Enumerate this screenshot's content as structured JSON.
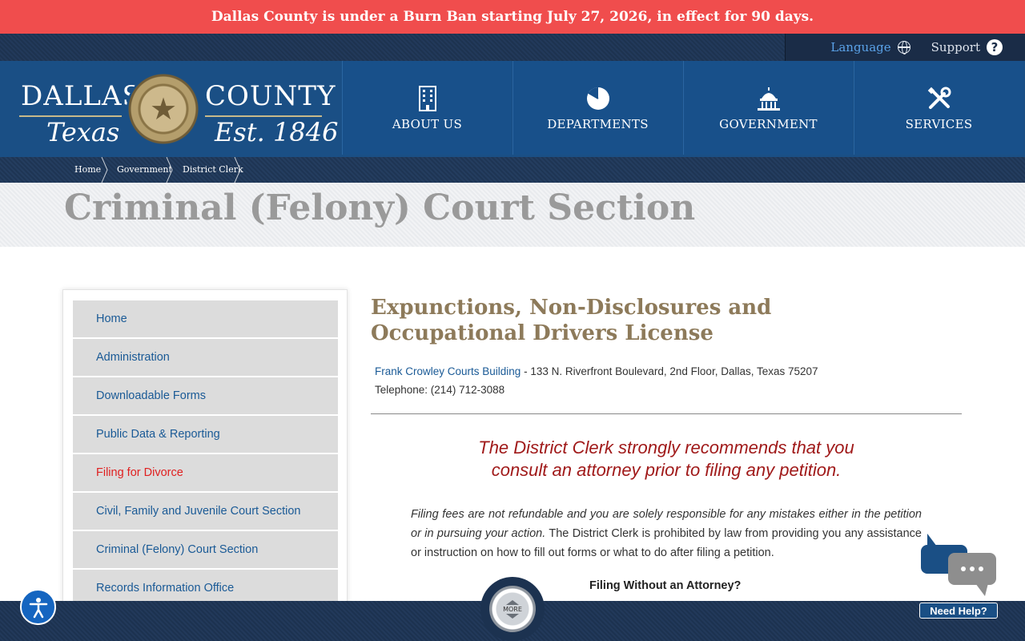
{
  "alert": {
    "text": "Dallas County is under a Burn Ban starting July 27, 2026, in effect for 90 days."
  },
  "utility": {
    "language": "Language",
    "support": "Support"
  },
  "logo": {
    "line1_left": "DALLAS",
    "line1_right": "COUNTY",
    "line2_left": "Texas",
    "line2_right": "Est. 1846"
  },
  "nav": [
    {
      "label": "ABOUT US",
      "icon": "building-icon"
    },
    {
      "label": "DEPARTMENTS",
      "icon": "pie-chart-icon"
    },
    {
      "label": "GOVERNMENT",
      "icon": "capitol-icon"
    },
    {
      "label": "SERVICES",
      "icon": "tools-icon"
    }
  ],
  "breadcrumb": [
    "Home",
    "Government",
    "District Clerk"
  ],
  "page_title": "Criminal (Felony) Court Section",
  "sidebar": {
    "items": [
      {
        "label": "Home"
      },
      {
        "label": "Administration"
      },
      {
        "label": "Downloadable Forms"
      },
      {
        "label": "Public Data & Reporting"
      },
      {
        "label": "Filing for Divorce"
      },
      {
        "label": "Civil, Family and Juvenile Court Section"
      },
      {
        "label": "Criminal (Felony) Court Section"
      },
      {
        "label": "Records Information Office"
      }
    ]
  },
  "content": {
    "title": "Expunctions, Non-Disclosures and Occupational Drivers License",
    "building_link": "Frank Crowley Courts Building",
    "address": " - 133 N. Riverfront Boulevard, 2nd Floor, Dallas, Texas 75207",
    "telephone": "Telephone: (214) 712-3088",
    "recommend_line1": "The District Clerk strongly recommends that you",
    "recommend_line2": "consult an attorney prior to filing any petition.",
    "para_italic": "Filing fees are not refundable and you are solely responsible for any mistakes either in the petition or in pursuing your action.",
    "para_rest": " The District Clerk is prohibited by law from providing you any assistance or instruction on how to fill out forms or what to do after filing a petition.",
    "subheading": "Filing Without an Attorney?"
  },
  "widgets": {
    "more_label": "MORE",
    "chat_label": "Need Help?"
  },
  "colors": {
    "alert": "#f04d4d",
    "header": "#1a4f85",
    "title_tan": "#8d7a5a",
    "recommend_red": "#a01a1a",
    "link_blue": "#1a5a96",
    "active_red": "#e02020"
  }
}
